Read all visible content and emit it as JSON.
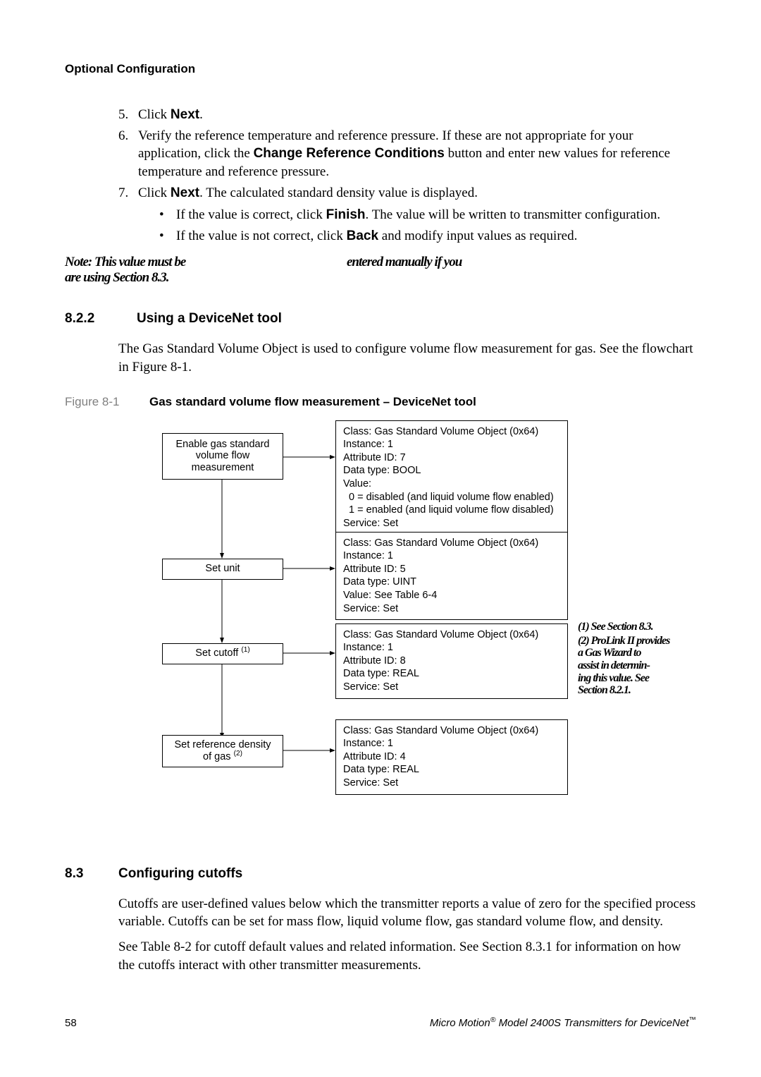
{
  "running_head": "Optional Configuration",
  "steps": {
    "s5_num": "5.",
    "s5_a": "Click ",
    "s5_b": "Next",
    "s5_c": ".",
    "s6_num": "6.",
    "s6_a": "Verify the reference temperature and reference pressure. If these are not appropriate for your application, click the ",
    "s6_b": "Change Reference Conditions",
    "s6_c": " button and enter new values for reference temperature and reference pressure.",
    "s7_num": "7.",
    "s7_a": "Click ",
    "s7_b": "Next",
    "s7_c": ". The calculated standard density value is displayed.",
    "b1_a": "If the value is correct, click ",
    "b1_b": "Finish",
    "b1_c": ". The value will be written to transmitter configuration.",
    "b2_a": "If the value is not correct, click ",
    "b2_b": "Back",
    "b2_c": " and modify input values as required."
  },
  "note_left": "Note: This value must be",
  "note_right": "entered manually if you",
  "note_body": "are using Section 8.3.",
  "h3": {
    "num": "8.2.2",
    "title": "Using a DeviceNet tool"
  },
  "p_822": "The Gas Standard Volume Object is used to configure volume flow measurement for gas. See the flowchart in Figure 8-1.",
  "fig": {
    "num": "Figure 8-1",
    "title": "Gas standard volume flow measurement – DeviceNet tool"
  },
  "flow": {
    "b1": "Enable gas standard\nvolume flow\nmeasurement",
    "d1": "Class: Gas Standard Volume Object (0x64)\nInstance: 1\nAttribute ID: 7\nData type: BOOL\nValue:\n  0 = disabled (and liquid volume flow enabled)\n  1 = enabled (and liquid volume flow disabled)\nService: Set",
    "b2": "Set unit",
    "d2": "Class: Gas Standard Volume Object (0x64)\nInstance: 1\nAttribute ID: 5\nData type: UINT\nValue: See Table 6-4\nService: Set",
    "b3": "Set cutoff (1)",
    "d3": "Class: Gas Standard Volume Object (0x64)\nInstance: 1\nAttribute ID: 8\nData type: REAL\nService: Set",
    "b4": "Set reference density\nof gas (2)",
    "d4": "Class: Gas Standard Volume Object (0x64)\nInstance: 1\nAttribute ID: 4\nData type: REAL\nService: Set",
    "annot1": "(1) See Section 8.3.",
    "annot2": "(2) ProLink II provides\na Gas Wizard to\nassist in determin-\ning this value. See\nSection 8.2.1."
  },
  "h2": {
    "num": "8.3",
    "title": "Configuring cutoffs"
  },
  "p_83a": "Cutoffs are user-defined values below which the transmitter reports a value of zero for the specified process variable. Cutoffs can be set for mass flow, liquid volume flow, gas standard volume flow, and density.",
  "p_83b": "See Table 8-2 for cutoff default values and related information. See Section 8.3.1 for information on how the cutoffs interact with other transmitter measurements.",
  "footer": {
    "pagenum": "58",
    "pub_a": "Micro Motion",
    "pub_b": " Model 2400S Transmitters for DeviceNet",
    "reg": "®",
    "tm": "™"
  }
}
